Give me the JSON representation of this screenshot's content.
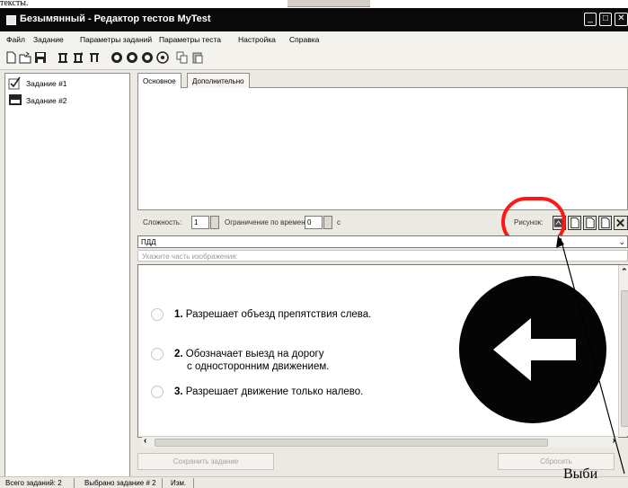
{
  "app": {
    "title": "Безымянный - Редактор тестов MyTest"
  },
  "doc_fragment": "тексты.",
  "menu": [
    "Файл",
    "Задание",
    "Параметры заданий",
    "Параметры теста",
    "Настройка",
    "Справка"
  ],
  "toolbar_icons": [
    "new-icon",
    "open-icon",
    "save-icon",
    "task-add-icon",
    "task-add-icon",
    "task-delete-icon",
    "circle-button-1-icon",
    "circle-button-2-icon",
    "circle-button-3-icon",
    "circle-button-4-icon",
    "copy-icon",
    "paste-icon"
  ],
  "tasks": [
    {
      "label": "Задание #1"
    },
    {
      "label": "Задание #2"
    }
  ],
  "tabs": [
    {
      "label": "Основное"
    },
    {
      "label": "Дополнительно"
    }
  ],
  "options": {
    "difficulty_label": "Сложность:",
    "difficulty_value": "1",
    "time_label": "Ограничение по времени:",
    "time_value": "0",
    "time_unit": "с",
    "picture_label": "Рисунок:"
  },
  "category": "ПДД",
  "hint": "Укажите часть изображения:",
  "answers": [
    {
      "num": "1.",
      "text": "Разрешает объезд препятствия слева.",
      "text2": ""
    },
    {
      "num": "2.",
      "text": "Обозначает выезд на дорогу",
      "text2": "с односторонним движением."
    },
    {
      "num": "3.",
      "text": "Разрешает движение только налево.",
      "text2": ""
    }
  ],
  "buttons": {
    "save": "Сохранить задание",
    "reset": "Сбросить"
  },
  "status": {
    "total": "Всего заданий: 2",
    "selected": "Выбрано задание # 2",
    "changed": "Изм."
  },
  "overlay_text": "Выби"
}
